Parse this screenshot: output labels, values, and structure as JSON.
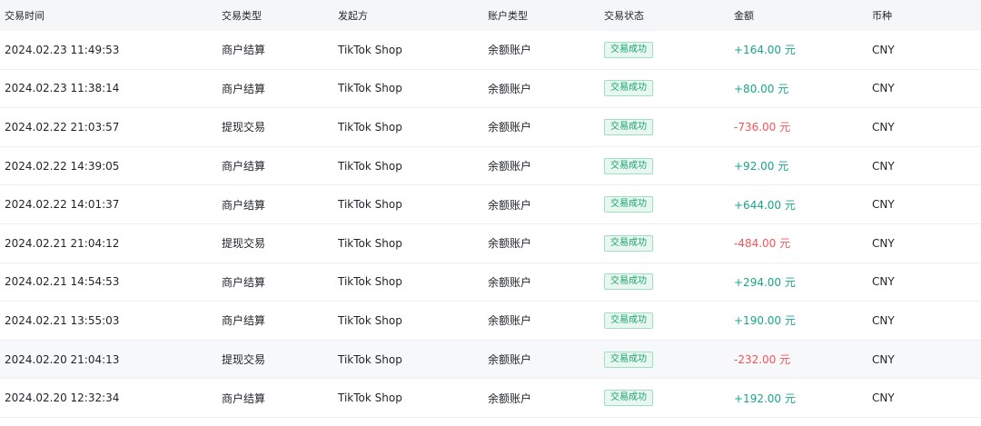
{
  "table": {
    "headers": {
      "time": "交易时间",
      "type": "交易类型",
      "initiator": "发起方",
      "account": "账户类型",
      "status": "交易状态",
      "amount": "金额",
      "currency": "币种"
    },
    "rows": [
      {
        "time": "2024.02.23 11:49:53",
        "type": "商户结算",
        "initiator": "TikTok Shop",
        "account": "余额账户",
        "status": "交易成功",
        "amount": "+164.00 元",
        "currency": "CNY"
      },
      {
        "time": "2024.02.23 11:38:14",
        "type": "商户结算",
        "initiator": "TikTok Shop",
        "account": "余额账户",
        "status": "交易成功",
        "amount": "+80.00 元",
        "currency": "CNY"
      },
      {
        "time": "2024.02.22 21:03:57",
        "type": "提现交易",
        "initiator": "TikTok Shop",
        "account": "余额账户",
        "status": "交易成功",
        "amount": "-736.00 元",
        "currency": "CNY"
      },
      {
        "time": "2024.02.22 14:39:05",
        "type": "商户结算",
        "initiator": "TikTok Shop",
        "account": "余额账户",
        "status": "交易成功",
        "amount": "+92.00 元",
        "currency": "CNY"
      },
      {
        "time": "2024.02.22 14:01:37",
        "type": "商户结算",
        "initiator": "TikTok Shop",
        "account": "余额账户",
        "status": "交易成功",
        "amount": "+644.00 元",
        "currency": "CNY"
      },
      {
        "time": "2024.02.21 21:04:12",
        "type": "提现交易",
        "initiator": "TikTok Shop",
        "account": "余额账户",
        "status": "交易成功",
        "amount": "-484.00 元",
        "currency": "CNY"
      },
      {
        "time": "2024.02.21 14:54:53",
        "type": "商户结算",
        "initiator": "TikTok Shop",
        "account": "余额账户",
        "status": "交易成功",
        "amount": "+294.00 元",
        "currency": "CNY"
      },
      {
        "time": "2024.02.21 13:55:03",
        "type": "商户结算",
        "initiator": "TikTok Shop",
        "account": "余额账户",
        "status": "交易成功",
        "amount": "+190.00 元",
        "currency": "CNY"
      },
      {
        "time": "2024.02.20 21:04:13",
        "type": "提现交易",
        "initiator": "TikTok Shop",
        "account": "余额账户",
        "status": "交易成功",
        "amount": "-232.00 元",
        "currency": "CNY"
      },
      {
        "time": "2024.02.20 12:32:34",
        "type": "商户结算",
        "initiator": "TikTok Shop",
        "account": "余额账户",
        "status": "交易成功",
        "amount": "+192.00 元",
        "currency": "CNY"
      }
    ]
  },
  "colors": {
    "positive_amount": "#18a58d",
    "negative_amount": "#f2545b",
    "status_badge": "#1aa36f",
    "header_bg": "#f5f6f7"
  }
}
